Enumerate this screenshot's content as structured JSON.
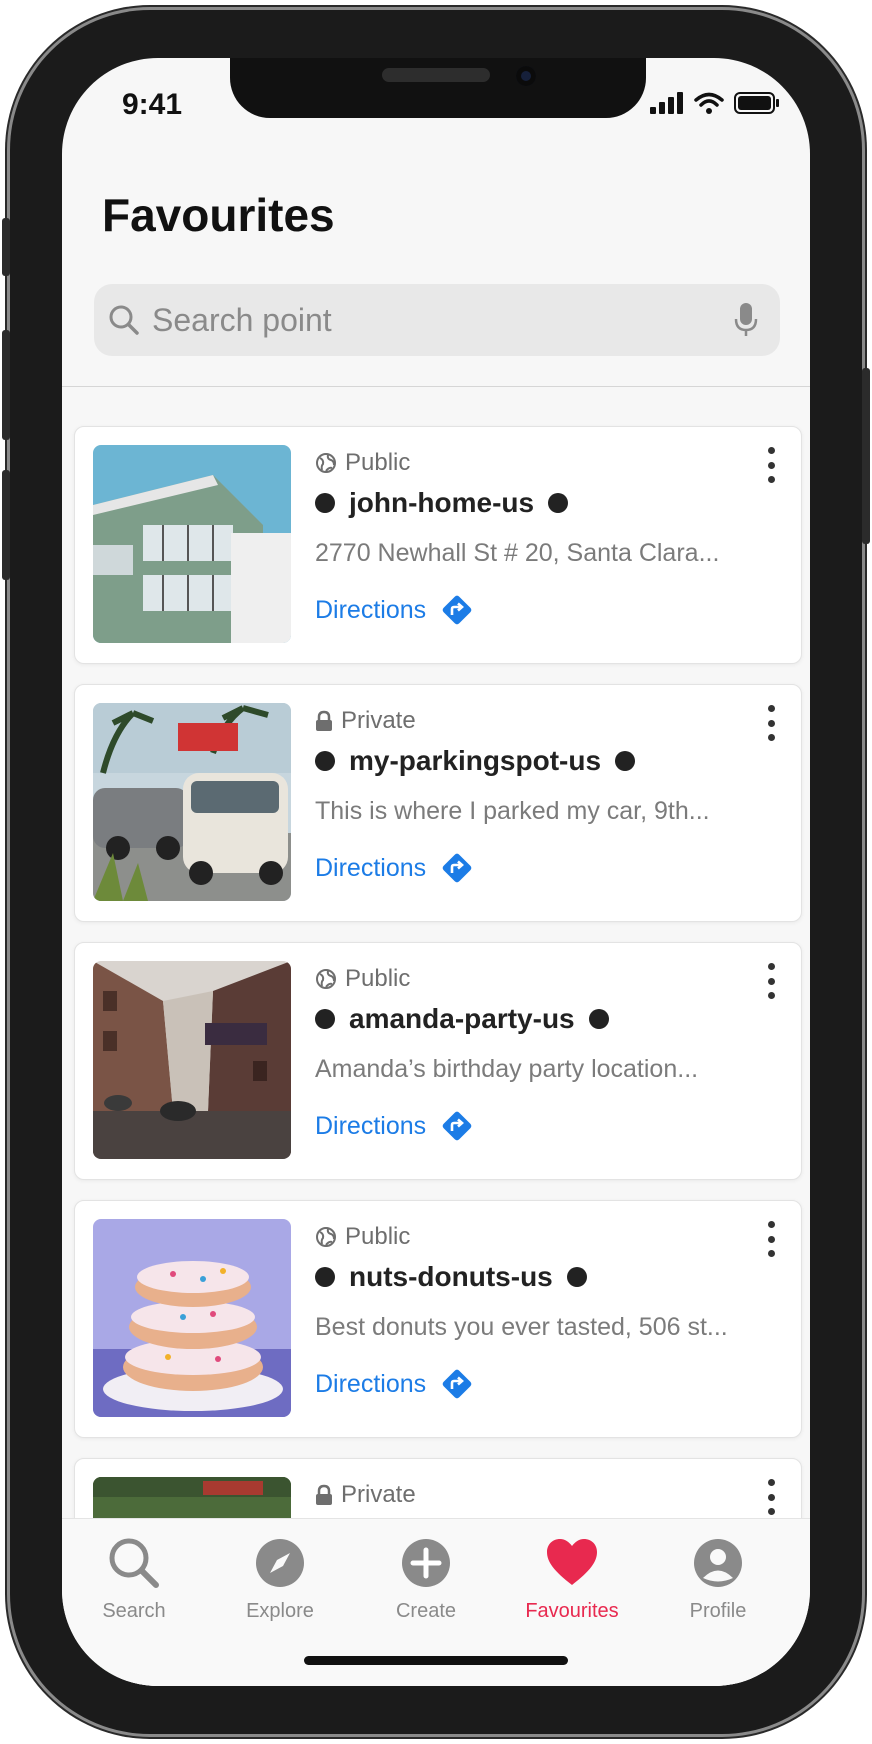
{
  "status_bar": {
    "time": "9:41"
  },
  "page": {
    "title": "Favourites"
  },
  "search": {
    "placeholder": "Search point"
  },
  "favourites": [
    {
      "visibility": "Public",
      "visibility_icon": "globe-icon",
      "name": "john-home-us",
      "description": "2770 Newhall St # 20, Santa Clara...",
      "directions_label": "Directions",
      "image": "building-photo"
    },
    {
      "visibility": "Private",
      "visibility_icon": "lock-icon",
      "name": "my-parkingspot-us",
      "description": "This is where I parked my car, 9th...",
      "directions_label": "Directions",
      "image": "parking-lot-photo"
    },
    {
      "visibility": "Public",
      "visibility_icon": "globe-icon",
      "name": "amanda-party-us",
      "description": "Amanda’s birthday party location...",
      "directions_label": "Directions",
      "image": "street-hotel-photo"
    },
    {
      "visibility": "Public",
      "visibility_icon": "globe-icon",
      "name": "nuts-donuts-us",
      "description": "Best donuts you ever tasted, 506 st...",
      "directions_label": "Directions",
      "image": "donuts-photo"
    },
    {
      "visibility": "Private",
      "visibility_icon": "lock-icon",
      "image": "garden-photo"
    }
  ],
  "tabs": [
    {
      "label": "Search",
      "icon": "search-icon"
    },
    {
      "label": "Explore",
      "icon": "compass-icon"
    },
    {
      "label": "Create",
      "icon": "plus-circle-icon"
    },
    {
      "label": "Favourites",
      "icon": "heart-icon",
      "active": true
    },
    {
      "label": "Profile",
      "icon": "profile-icon"
    }
  ],
  "colors": {
    "accent": "#e8294f",
    "link": "#1c7ce6",
    "text": "#222222",
    "muted": "#7b7b7b"
  }
}
